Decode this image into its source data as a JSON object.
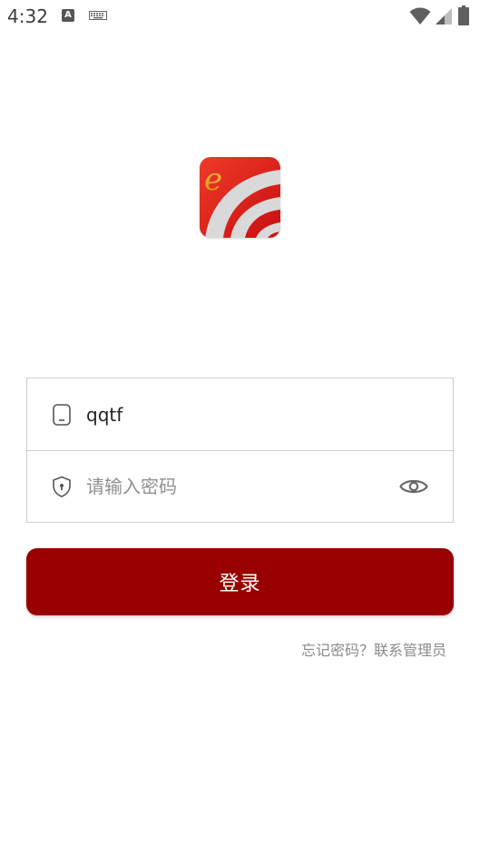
{
  "status_bar": {
    "time": "4:32",
    "notification_letter": "A"
  },
  "login": {
    "username_value": "qqtf",
    "password_placeholder": "请输入密码",
    "login_label": "登录",
    "forgot_label": "忘记密码？联系管理员"
  },
  "colors": {
    "primary": "#990000",
    "border": "#cfcfcf",
    "hint_text": "#8a8a8a"
  }
}
